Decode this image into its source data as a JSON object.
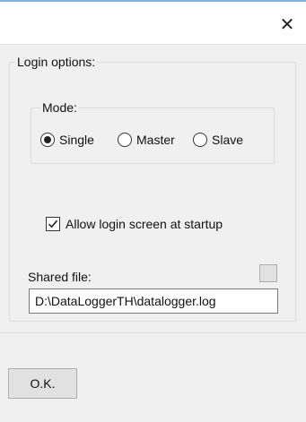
{
  "window": {
    "close_glyph": "✕"
  },
  "login_options": {
    "legend": "Login options:",
    "mode": {
      "legend": "Mode:",
      "options": [
        {
          "label": "Single",
          "checked": true
        },
        {
          "label": "Master",
          "checked": false
        },
        {
          "label": "Slave",
          "checked": false
        }
      ]
    },
    "allow_login": {
      "label": "Allow login screen at startup",
      "checked": true
    },
    "shared_file": {
      "label": "Shared file:",
      "value": "D:\\DataLoggerTH\\datalogger.log"
    }
  },
  "footer": {
    "ok_label": "O.K."
  }
}
